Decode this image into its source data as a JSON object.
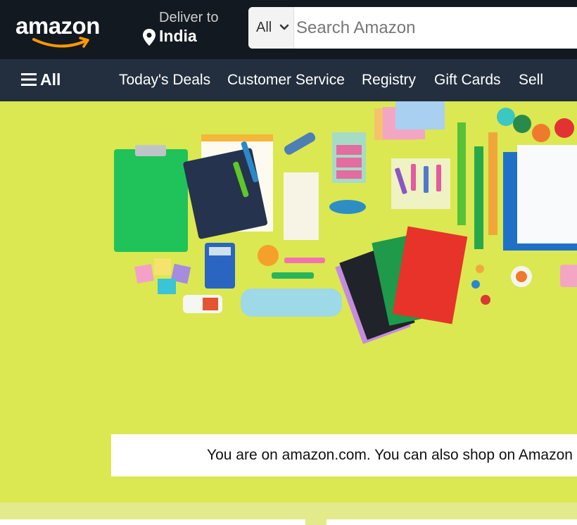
{
  "header": {
    "logo_text": "amazon",
    "deliver_to_label": "Deliver to",
    "deliver_to_location": "India",
    "search_category": "All",
    "search_placeholder": "Search Amazon"
  },
  "nav": {
    "all_label": "All",
    "items": [
      "Today's Deals",
      "Customer Service",
      "Registry",
      "Gift Cards",
      "Sell"
    ]
  },
  "hero": {
    "notice_text": "You are on amazon.com. You can also shop on Amazon In"
  },
  "colors": {
    "header_bg": "#131921",
    "nav_bg": "#232f3e",
    "hero_bg": "#dbe851",
    "logo_smile": "#ff9900"
  },
  "icons": [
    "amazon-smile-icon",
    "location-pin-icon",
    "chevron-down-icon",
    "hamburger-icon"
  ]
}
